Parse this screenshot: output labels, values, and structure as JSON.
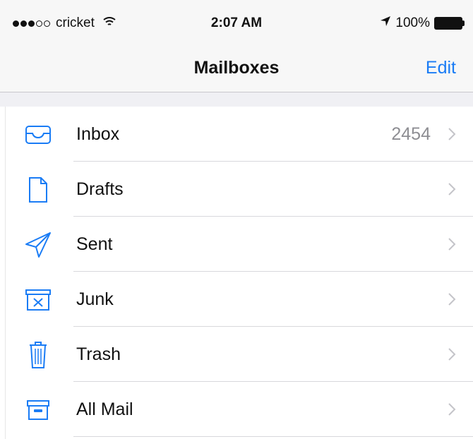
{
  "status_bar": {
    "carrier": "cricket",
    "time": "2:07 AM",
    "battery": "100%"
  },
  "nav": {
    "title": "Mailboxes",
    "edit_label": "Edit"
  },
  "mailboxes": [
    {
      "label": "Inbox",
      "count": "2454",
      "icon": "inbox-tray-icon"
    },
    {
      "label": "Drafts",
      "count": "",
      "icon": "document-icon"
    },
    {
      "label": "Sent",
      "count": "",
      "icon": "paper-plane-icon"
    },
    {
      "label": "Junk",
      "count": "",
      "icon": "junk-box-icon"
    },
    {
      "label": "Trash",
      "count": "",
      "icon": "trash-can-icon"
    },
    {
      "label": "All Mail",
      "count": "",
      "icon": "archive-box-icon"
    }
  ],
  "colors": {
    "accent": "#1a7cf5",
    "secondary_text": "#8e8e93"
  }
}
